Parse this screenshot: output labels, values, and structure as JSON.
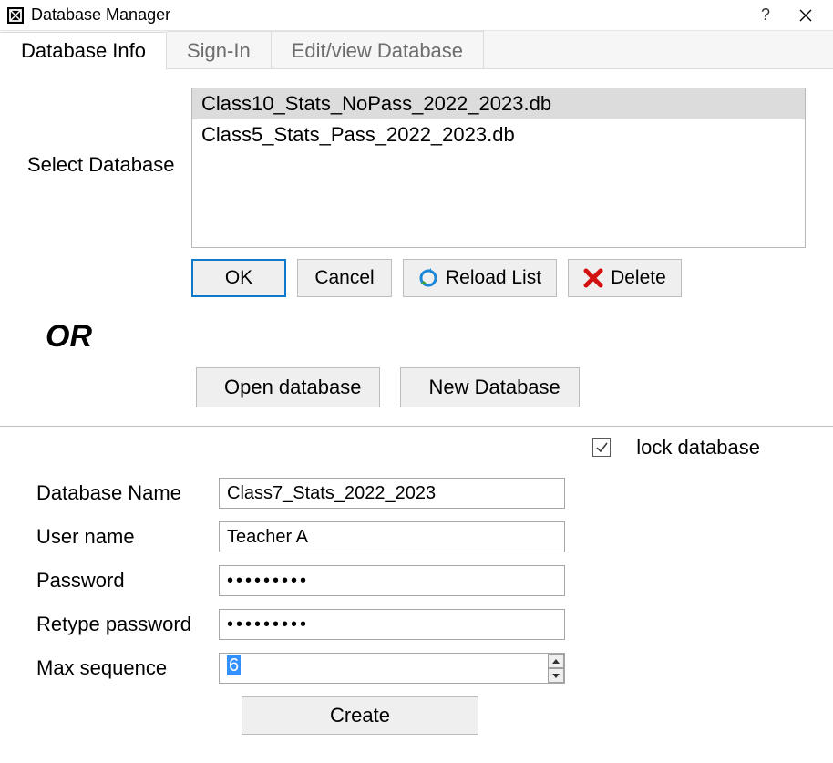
{
  "window": {
    "title": "Database Manager"
  },
  "tabs": [
    {
      "label": "Database Info",
      "active": true
    },
    {
      "label": "Sign-In",
      "active": false
    },
    {
      "label": "Edit/view Database",
      "active": false
    }
  ],
  "select_db_label": "Select Database",
  "database_list": [
    {
      "name": "Class10_Stats_NoPass_2022_2023.db",
      "selected": true
    },
    {
      "name": "Class5_Stats_Pass_2022_2023.db",
      "selected": false
    }
  ],
  "buttons": {
    "ok": "OK",
    "cancel": "Cancel",
    "reload": "Reload List",
    "delete": "Delete",
    "open_db": "Open database",
    "new_db": "New Database",
    "create": "Create"
  },
  "or_label": "OR",
  "lock": {
    "checked": true,
    "label": "lock database"
  },
  "form": {
    "database_name": {
      "label": "Database Name",
      "value": "Class7_Stats_2022_2023"
    },
    "user_name": {
      "label": "User name",
      "value": "Teacher A"
    },
    "password": {
      "label": "Password",
      "value": "•••••••••"
    },
    "retype": {
      "label": "Retype password",
      "value": "•••••••••"
    },
    "max_seq": {
      "label": "Max sequence",
      "value": "6"
    }
  }
}
